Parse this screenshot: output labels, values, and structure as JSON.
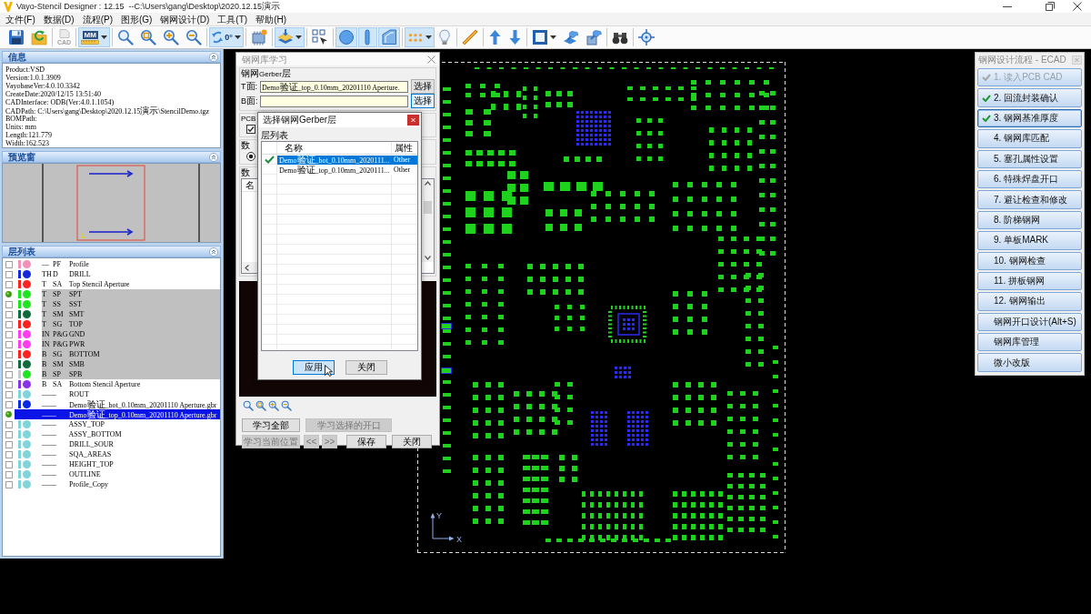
{
  "window": {
    "title": "Vayo-Stencil Designer : 12.15  --C:\\Users\\gang\\Desktop\\2020.12.15演示"
  },
  "menu": [
    {
      "label": "文件(F)"
    },
    {
      "label": "数据(D)"
    },
    {
      "label": "流程(P)"
    },
    {
      "label": "图形(G)"
    },
    {
      "label": "钢网设计(D)"
    },
    {
      "label": "工具(T)"
    },
    {
      "label": "帮助(H)"
    }
  ],
  "toolbar": {
    "groups": [
      [
        {
          "kind": "save",
          "active": false,
          "disabled": false,
          "dropdown": false
        },
        {
          "kind": "import",
          "active": false,
          "disabled": false,
          "dropdown": false
        }
      ],
      [
        {
          "kind": "cad",
          "label": "CAD",
          "active": false,
          "disabled": true,
          "dropdown": false
        }
      ],
      [
        {
          "kind": "units",
          "label": "MM",
          "active": true,
          "disabled": false,
          "dropdown": true
        }
      ],
      [
        {
          "kind": "zoom",
          "active": false,
          "disabled": false,
          "dropdown": false
        },
        {
          "kind": "zoom_fit",
          "active": false,
          "disabled": false,
          "dropdown": false
        },
        {
          "kind": "zoom_in",
          "active": false,
          "disabled": false,
          "dropdown": false
        },
        {
          "kind": "zoom_out",
          "active": false,
          "disabled": false,
          "dropdown": false
        }
      ],
      [
        {
          "kind": "rotate",
          "label": "0°",
          "active": true,
          "disabled": false,
          "dropdown": true
        }
      ],
      [
        {
          "kind": "board",
          "active": false,
          "disabled": false,
          "dropdown": false
        }
      ],
      [
        {
          "kind": "layers",
          "active": true,
          "disabled": false,
          "dropdown": true
        }
      ],
      [
        {
          "kind": "select",
          "active": false,
          "disabled": false,
          "dropdown": false
        }
      ],
      [
        {
          "kind": "circle",
          "active": true,
          "disabled": false,
          "dropdown": false
        },
        {
          "kind": "bar",
          "active": true,
          "disabled": false,
          "dropdown": false
        },
        {
          "kind": "shape",
          "active": true,
          "disabled": false,
          "dropdown": false
        }
      ],
      [
        {
          "kind": "dots",
          "active": true,
          "disabled": false,
          "dropdown": true
        },
        {
          "kind": "bulb",
          "active": false,
          "disabled": false,
          "dropdown": false
        }
      ],
      [
        {
          "kind": "ruler",
          "active": false,
          "disabled": false,
          "dropdown": false
        }
      ],
      [
        {
          "kind": "up",
          "active": false,
          "disabled": false,
          "dropdown": false
        },
        {
          "kind": "down",
          "active": false,
          "disabled": false,
          "dropdown": false
        }
      ],
      [
        {
          "kind": "square",
          "active": false,
          "disabled": false,
          "dropdown": true
        },
        {
          "kind": "tool",
          "active": false,
          "disabled": false,
          "dropdown": false
        },
        {
          "kind": "tool_alt",
          "active": false,
          "disabled": false,
          "dropdown": false
        }
      ],
      [
        {
          "kind": "binoculars",
          "active": false,
          "disabled": false,
          "dropdown": false
        }
      ],
      [
        {
          "kind": "crosshair",
          "active": false,
          "disabled": false,
          "dropdown": false
        }
      ]
    ]
  },
  "info_panel": {
    "title": "信息",
    "lines": [
      "Product:VSD",
      "Version:1.0.1.3909",
      "VayobaseVer:4.0.10.3342",
      "CreateDate:2020/12/15 13:51:40",
      "CADInterface: ODB(Ver:4.0.1.1054)",
      "CADPath: C:\\Users\\gang\\Desktop\\2020.12.15演示\\StencilDemo.tgz",
      "BOMPath:",
      "Units: mm",
      "Length:121.779",
      "Width:162.523"
    ]
  },
  "preview_panel": {
    "title": "预览窗"
  },
  "layer_panel": {
    "title": "层列表",
    "layers": [
      {
        "active": false,
        "swatches": [
          {
            "kind": "bar",
            "color": "#f590b8"
          },
          {
            "kind": "dot",
            "color": "#f590b8"
          }
        ],
        "side": "—",
        "type": "PF",
        "name": "Profile",
        "shaded": false,
        "selected": false
      },
      {
        "active": false,
        "swatches": [
          {
            "kind": "bar",
            "color": "#1428dc"
          },
          {
            "kind": "dot",
            "color": "#1428dc"
          }
        ],
        "side": "TH",
        "type": "D",
        "name": "DRILL",
        "shaded": false,
        "selected": false
      },
      {
        "active": false,
        "swatches": [
          {
            "kind": "bar",
            "color": "#ff2020"
          },
          {
            "kind": "dot",
            "color": "#ff2020"
          }
        ],
        "side": "T",
        "type": "SA",
        "name": "Top Stencil Aperture",
        "shaded": false,
        "selected": false
      },
      {
        "active": true,
        "swatches": [
          {
            "kind": "bar",
            "color": "#1ee61e"
          },
          {
            "kind": "dot",
            "color": "#1ee61e"
          }
        ],
        "side": "T",
        "type": "SP",
        "name": "SPT",
        "shaded": true,
        "selected": false
      },
      {
        "active": false,
        "swatches": [
          {
            "kind": "bar",
            "color": "#1ee61e"
          },
          {
            "kind": "dot",
            "color": "#1ee61e"
          }
        ],
        "side": "T",
        "type": "SS",
        "name": "SST",
        "shaded": true,
        "selected": false
      },
      {
        "active": false,
        "swatches": [
          {
            "kind": "bar",
            "color": "#0f6b3c"
          },
          {
            "kind": "dot",
            "color": "#0f6b3c"
          }
        ],
        "side": "T",
        "type": "SM",
        "name": "SMT",
        "shaded": true,
        "selected": false
      },
      {
        "active": false,
        "swatches": [
          {
            "kind": "bar",
            "color": "#ff2020"
          },
          {
            "kind": "dot",
            "color": "#ff2020"
          }
        ],
        "side": "T",
        "type": "SG",
        "name": "TOP",
        "shaded": true,
        "selected": false
      },
      {
        "active": false,
        "swatches": [
          {
            "kind": "bar",
            "color": "#ff3cf0"
          },
          {
            "kind": "dot",
            "color": "#ff3cf0"
          }
        ],
        "side": "IN",
        "type": "P&G",
        "name": "GND",
        "shaded": true,
        "selected": false
      },
      {
        "active": false,
        "swatches": [
          {
            "kind": "bar",
            "color": "#ff3cf0"
          },
          {
            "kind": "dot",
            "color": "#ff3cf0"
          }
        ],
        "side": "IN",
        "type": "P&G",
        "name": "PWR",
        "shaded": true,
        "selected": false
      },
      {
        "active": false,
        "swatches": [
          {
            "kind": "bar",
            "color": "#ff2020"
          },
          {
            "kind": "dot",
            "color": "#ff2020"
          }
        ],
        "side": "B",
        "type": "SG",
        "name": "BOTTOM",
        "shaded": true,
        "selected": false
      },
      {
        "active": false,
        "swatches": [
          {
            "kind": "bar",
            "color": "#0f6b3c"
          },
          {
            "kind": "dot",
            "color": "#0f6b3c"
          }
        ],
        "side": "B",
        "type": "SM",
        "name": "SMB",
        "shaded": true,
        "selected": false
      },
      {
        "active": false,
        "swatches": [
          {
            "kind": "bar",
            "color": "#c8c8c8"
          },
          {
            "kind": "dot",
            "color": "#1ee61e"
          }
        ],
        "side": "B",
        "type": "SP",
        "name": "SPB",
        "shaded": true,
        "selected": false
      },
      {
        "active": false,
        "swatches": [
          {
            "kind": "bar",
            "color": "#8c32e6"
          },
          {
            "kind": "dot",
            "color": "#8c32e6"
          }
        ],
        "side": "B",
        "type": "SA",
        "name": "Bottom Stencil Aperture",
        "shaded": false,
        "selected": false
      },
      {
        "active": false,
        "swatches": [
          {
            "kind": "bar",
            "color": "#80d4dc"
          },
          {
            "kind": "dot",
            "color": "#80d4dc"
          }
        ],
        "side": "——",
        "name": "ROUT",
        "shaded": false,
        "selected": false
      },
      {
        "active": false,
        "swatches": [
          {
            "kind": "bar",
            "color": "#0a28e6"
          },
          {
            "kind": "dot",
            "color": "#0a28e6"
          }
        ],
        "side": "——",
        "name": "Demo验证_bot_0.10mm_20201110 Aperture.gbr",
        "shaded": false,
        "selected": false
      },
      {
        "active": true,
        "side": "——",
        "name": "Demo验证_top_0.10mm_20201110 Aperture.gbr",
        "shaded": false,
        "selected": true
      },
      {
        "active": false,
        "swatches": [
          {
            "kind": "bar",
            "color": "#80d4dc"
          },
          {
            "kind": "dot",
            "color": "#80d4dc"
          }
        ],
        "side": "——",
        "name": "ASSY_TOP",
        "shaded": false,
        "selected": false
      },
      {
        "active": false,
        "swatches": [
          {
            "kind": "bar",
            "color": "#80d4dc"
          },
          {
            "kind": "dot",
            "color": "#80d4dc"
          }
        ],
        "side": "——",
        "name": "ASSY_BOTTOM",
        "shaded": false,
        "selected": false
      },
      {
        "active": false,
        "swatches": [
          {
            "kind": "bar",
            "color": "#80d4dc"
          },
          {
            "kind": "dot",
            "color": "#80d4dc"
          }
        ],
        "side": "——",
        "name": "DRILL_SOUR",
        "shaded": false,
        "selected": false
      },
      {
        "active": false,
        "swatches": [
          {
            "kind": "bar",
            "color": "#80d4dc"
          },
          {
            "kind": "dot",
            "color": "#80d4dc"
          }
        ],
        "side": "——",
        "name": "SQA_AREAS",
        "shaded": false,
        "selected": false
      },
      {
        "active": false,
        "swatches": [
          {
            "kind": "bar",
            "color": "#80d4dc"
          },
          {
            "kind": "dot",
            "color": "#80d4dc"
          }
        ],
        "side": "——",
        "name": "HEIGHT_TOP",
        "shaded": false,
        "selected": false
      },
      {
        "active": false,
        "swatches": [
          {
            "kind": "bar",
            "color": "#80d4dc"
          },
          {
            "kind": "dot",
            "color": "#80d4dc"
          }
        ],
        "side": "——",
        "name": "OUTLINE",
        "shaded": false,
        "selected": false
      },
      {
        "active": false,
        "swatches": [
          {
            "kind": "bar",
            "color": "#80d4dc"
          },
          {
            "kind": "dot",
            "color": "#80d4dc"
          }
        ],
        "side": "——",
        "name": "Profile_Copy",
        "shaded": false,
        "selected": false
      }
    ]
  },
  "canvas": {
    "y_axis_label": "Y",
    "x_axis_label": "X"
  },
  "learn_dialog": {
    "title": "钢网库学习",
    "gerber_group": {
      "title": "钢网Gerber层",
      "fields": [
        {
          "label": "T面:",
          "value": "Demo验证_top_0.10mm_20201110 Aperture.",
          "button": "选择",
          "focused": false
        },
        {
          "label": "B面:",
          "button": "选择",
          "focused": true
        }
      ]
    },
    "pcb_group": {
      "title": "PCB",
      "checked": true
    },
    "option_group": {
      "title": "数",
      "selected": true
    },
    "list_group": {
      "title": "数",
      "columns": [
        "名"
      ]
    },
    "button_rows": [
      [
        {
          "label": "学习全部",
          "disabled": false
        },
        {
          "label": "学习选择的开口",
          "disabled": true
        }
      ],
      [
        {
          "label": "学习当前位置",
          "disabled": true
        },
        {
          "label": "<<",
          "disabled": true
        },
        {
          "label": ">>",
          "disabled": true
        },
        {
          "label": "保存",
          "disabled": false
        },
        {
          "label": "关闭",
          "disabled": false
        }
      ]
    ]
  },
  "layer_picker": {
    "title": "选择钢网Gerber层",
    "group_title": "层列表",
    "columns": [
      "名称",
      "属性"
    ],
    "rows": [
      {
        "name": "Demo验证_bot_0.10mm_2020111...",
        "attribute": "Other",
        "checked": true,
        "selected": true
      },
      {
        "name": "Demo验证_top_0.10mm_2020111...",
        "attribute": "Other",
        "checked": false,
        "selected": false
      }
    ],
    "buttons": [
      {
        "label": "应用",
        "focused": true
      },
      {
        "label": "关闭",
        "focused": false
      }
    ]
  },
  "flow_panel": {
    "title": "钢网设计流程 - ECAD",
    "steps": [
      {
        "label": "1. 读入PCB CAD",
        "done": true,
        "disabled": true,
        "focused": false
      },
      {
        "label": "2. 回流封装确认",
        "done": true,
        "disabled": false,
        "focused": false
      },
      {
        "label": "3. 钢网基准厚度",
        "done": true,
        "disabled": false,
        "focused": true
      },
      {
        "label": "4. 钢网库匹配",
        "done": false,
        "disabled": false,
        "focused": false
      },
      {
        "label": "5. 塞孔属性设置",
        "done": false,
        "disabled": false,
        "focused": false
      },
      {
        "label": "6. 特殊焊盘开口",
        "done": false,
        "disabled": false,
        "focused": false
      },
      {
        "label": "7. 避让检查和修改",
        "done": false,
        "disabled": false,
        "focused": false
      },
      {
        "label": "8. 阶梯钢网",
        "done": false,
        "disabled": false,
        "focused": false
      },
      {
        "label": "9. 单板MARK",
        "done": false,
        "disabled": false,
        "focused": false
      },
      {
        "label": "10. 钢网检查",
        "done": false,
        "disabled": false,
        "focused": false
      },
      {
        "label": "11. 拼板钢网",
        "done": false,
        "disabled": false,
        "focused": false
      },
      {
        "label": "12. 钢网输出",
        "done": false,
        "disabled": false,
        "focused": false
      },
      {
        "label": "钢网开口设计(Alt+S)",
        "done": false,
        "disabled": false,
        "focused": false
      },
      {
        "label": "钢网库管理",
        "done": false,
        "disabled": false,
        "focused": false
      },
      {
        "label": "微小改版",
        "done": false,
        "disabled": false,
        "focused": false
      }
    ]
  }
}
